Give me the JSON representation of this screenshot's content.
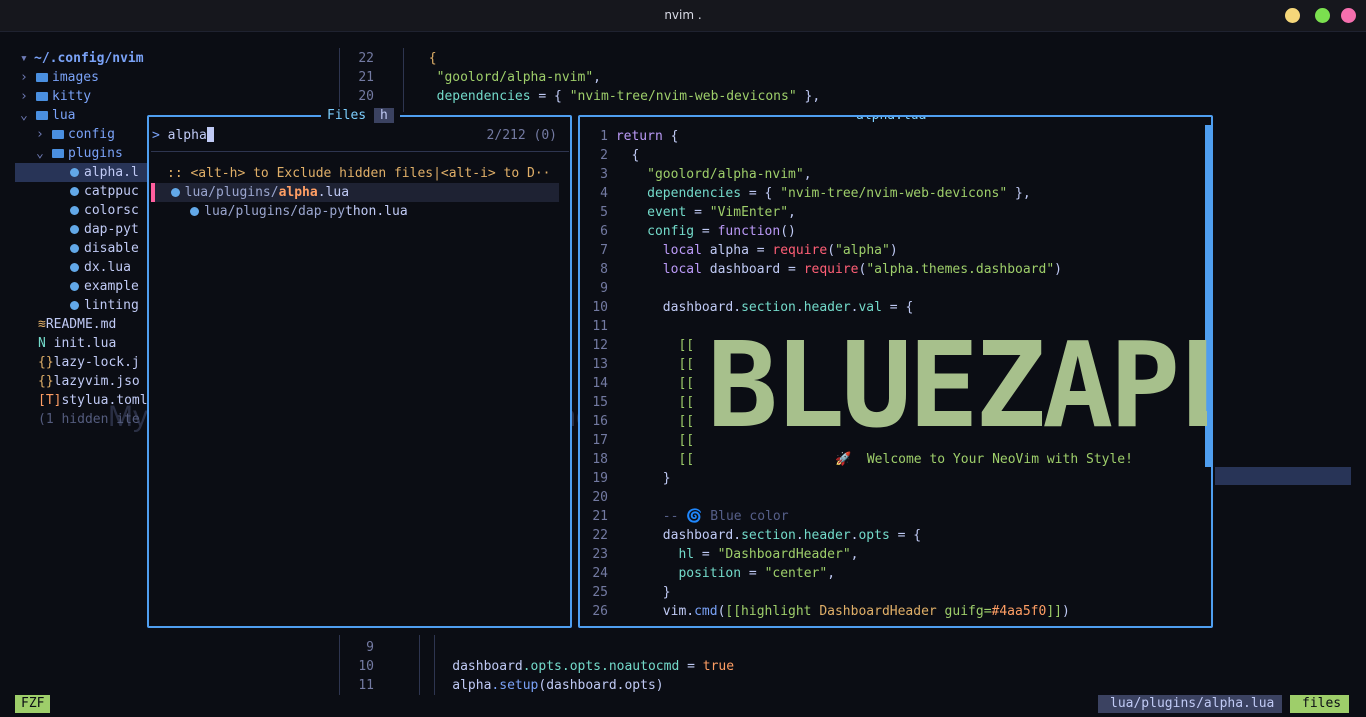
{
  "window": {
    "title": "nvim ."
  },
  "tree": {
    "root": "~/.config/nvim",
    "items": [
      "images",
      "kitty",
      "lua",
      "config",
      "plugins",
      "alpha.l",
      "catppuc",
      "colorsc",
      "dap-pyt",
      "disable",
      "dx.lua",
      "example",
      "linting",
      "README.md",
      "init.lua",
      "lazy-lock.j",
      "lazyvim.jso",
      "stylua.toml",
      "(1 hidden ite"
    ]
  },
  "bg_code": {
    "top": [
      {
        "ln": "22",
        "text": "{"
      },
      {
        "ln": "21",
        "s1": "\"goolord/alpha-nvim\"",
        "tail": ","
      },
      {
        "ln": "20",
        "a": "dependencies",
        "b": " = { ",
        "s1": "\"nvim-tree/nvim-web-devicons\"",
        "c": " },"
      }
    ],
    "bottom": [
      {
        "ln": "9"
      },
      {
        "ln": "10",
        "a": "dashboard",
        "b": ".opts.opts.noautocmd",
        "c": " = ",
        "d": "true"
      },
      {
        "ln": "11",
        "a": "alpha",
        "b": ".setup",
        "c": "(dashboard.opts)"
      }
    ]
  },
  "files_panel": {
    "title": "Files",
    "key": "h",
    "prompt": ">",
    "query": "alpha",
    "count": "2/212 (0)",
    "hint": ":: <alt-h> to Exclude hidden files|<alt-i> to D··",
    "results": [
      {
        "prefix": "lua/plugins/",
        "match": "alpha",
        "suffix": ".lua"
      },
      {
        "prefix": "lua/plugins/dap-py",
        "match": "",
        "suffix": "thon.lua"
      }
    ]
  },
  "preview": {
    "title": "alpha.lua",
    "lines": [
      {
        "n": "1",
        "html": "<span class='kw'>return</span> {"
      },
      {
        "n": "2",
        "html": "  {"
      },
      {
        "n": "3",
        "html": "    <span class='str'>\"goolord/alpha-nvim\"</span>,"
      },
      {
        "n": "4",
        "html": "    <span class='prop'>dependencies</span> = { <span class='str'>\"nvim-tree/nvim-web-devicons\"</span> },"
      },
      {
        "n": "5",
        "html": "    <span class='prop'>event</span> = <span class='str'>\"VimEnter\"</span>,"
      },
      {
        "n": "6",
        "html": "    <span class='prop'>config</span> = <span class='kw'>function</span>()"
      },
      {
        "n": "7",
        "html": "      <span class='kw'>local</span> alpha = <span class='red'>require</span>(<span class='str'>\"alpha\"</span>)"
      },
      {
        "n": "8",
        "html": "      <span class='kw'>local</span> dashboard = <span class='red'>require</span>(<span class='str'>\"alpha.themes.dashboard\"</span>)"
      },
      {
        "n": "9",
        "html": ""
      },
      {
        "n": "10",
        "html": "      dashboard.<span class='prop'>section</span>.<span class='prop'>header</span>.<span class='prop'>val</span> = {"
      },
      {
        "n": "11",
        "html": ""
      },
      {
        "n": "12",
        "html": "        <span class='str'>[[</span>"
      },
      {
        "n": "13",
        "html": "        <span class='str'>[[</span>"
      },
      {
        "n": "14",
        "html": "        <span class='str'>[[</span>"
      },
      {
        "n": "15",
        "html": "        <span class='str'>[[</span>"
      },
      {
        "n": "16",
        "html": "        <span class='str'>[[</span>"
      },
      {
        "n": "17",
        "html": "        <span class='str'>[[</span>"
      },
      {
        "n": "18",
        "html": "        <span class='str'>[[</span>                  🚀  <span class='str'>Welcome to Your NeoVim with Style!</span>"
      },
      {
        "n": "19",
        "html": "      }"
      },
      {
        "n": "20",
        "html": ""
      },
      {
        "n": "21",
        "html": "      <span class='cmt'>-- 🌀 Blue color</span>"
      },
      {
        "n": "22",
        "html": "      dashboard.<span class='prop'>section</span>.<span class='prop'>header</span>.<span class='prop'>opts</span> = {"
      },
      {
        "n": "23",
        "html": "        <span class='prop'>hl</span> = <span class='str'>\"DashboardHeader\"</span>,"
      },
      {
        "n": "24",
        "html": "        <span class='prop'>position</span> = <span class='str'>\"center\"</span>,"
      },
      {
        "n": "25",
        "html": "      }"
      },
      {
        "n": "26",
        "html": "      vim.<span class='fn'>cmd</span>(<span class='str'>[[highlight <span style='color:#e0af68'>DashboardHeader</span> guifg=<span class='num'>#4aa5f0</span>]]</span>)"
      }
    ]
  },
  "banner": {
    "text": "BLUEZAPL",
    "color": "#a7c08c"
  },
  "statusbar": {
    "mode": "FZF",
    "file": "lua/plugins/alpha.lua",
    "panel": "files"
  },
  "colors": {
    "accent": "#4f9ef0",
    "green": "#9ece6a",
    "bg": "#0b0d14"
  }
}
